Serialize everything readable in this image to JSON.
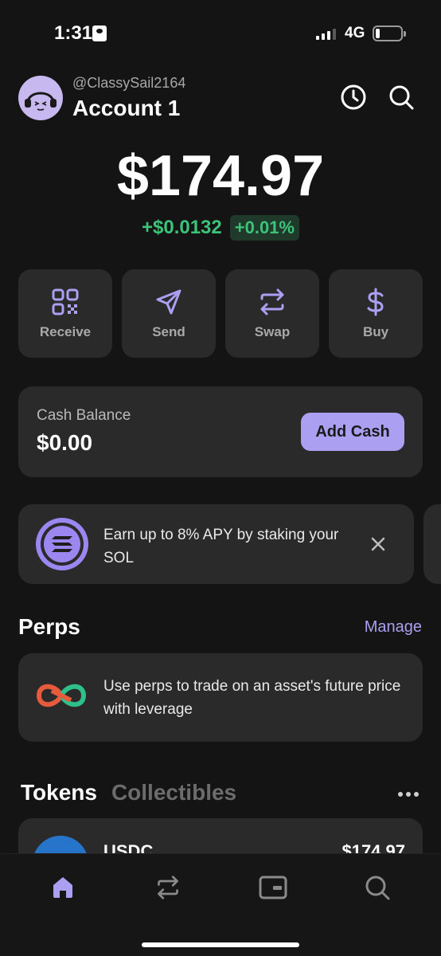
{
  "status_bar": {
    "time": "1:31",
    "network": "4G"
  },
  "header": {
    "handle": "@ClassySail2164",
    "account_name": "Account 1"
  },
  "balance": {
    "total": "$174.97",
    "change_amount": "+$0.0132",
    "change_percent": "+0.01%"
  },
  "actions": [
    {
      "label": "Receive",
      "icon": "qr-code-icon"
    },
    {
      "label": "Send",
      "icon": "send-arrow-icon"
    },
    {
      "label": "Swap",
      "icon": "swap-arrows-icon"
    },
    {
      "label": "Buy",
      "icon": "dollar-icon"
    }
  ],
  "cash": {
    "title": "Cash Balance",
    "value": "$0.00",
    "button": "Add Cash"
  },
  "promo": {
    "text": "Earn up to 8% APY by staking your SOL"
  },
  "perps": {
    "title": "Perps",
    "manage": "Manage",
    "text": "Use perps to trade on an asset's future price with leverage"
  },
  "tabs": {
    "tokens": "Tokens",
    "collectibles": "Collectibles"
  },
  "token_list": [
    {
      "name": "USDC",
      "value": "$174.97"
    }
  ],
  "nav": [
    "home-icon",
    "swap-icon",
    "wallet-icon",
    "search-icon"
  ],
  "colors": {
    "accent": "#ab9ff2",
    "positive": "#3cc37a",
    "card": "#2a2a2a",
    "background": "#141414"
  }
}
